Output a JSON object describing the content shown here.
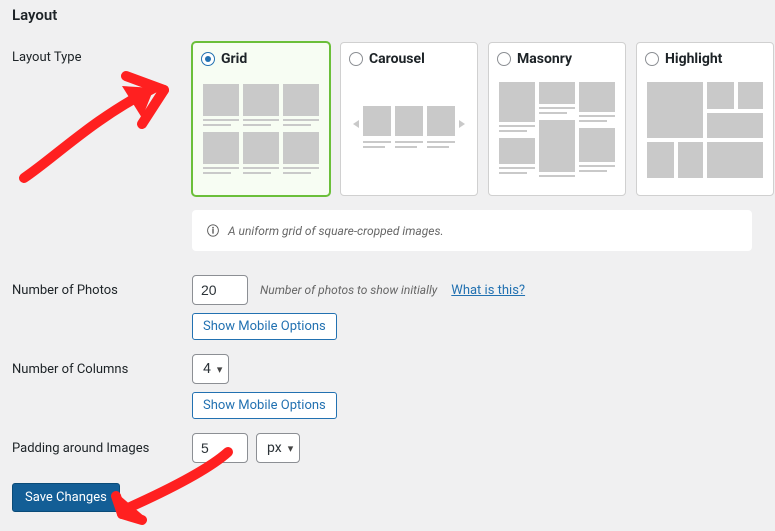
{
  "section_title": "Layout",
  "fields": {
    "layout_type": {
      "label": "Layout Type",
      "options": {
        "grid": "Grid",
        "carousel": "Carousel",
        "masonry": "Masonry",
        "highlight": "Highlight"
      },
      "selected": "grid",
      "info": "A uniform grid of square-cropped images."
    },
    "num_photos": {
      "label": "Number of Photos",
      "value": "20",
      "desc": "Number of photos to show initially",
      "help_link": "What is this?",
      "mobile_btn": "Show Mobile Options"
    },
    "num_columns": {
      "label": "Number of Columns",
      "value": "4",
      "mobile_btn": "Show Mobile Options"
    },
    "padding": {
      "label": "Padding around Images",
      "value": "5",
      "unit": "px"
    }
  },
  "buttons": {
    "save": "Save Changes"
  }
}
